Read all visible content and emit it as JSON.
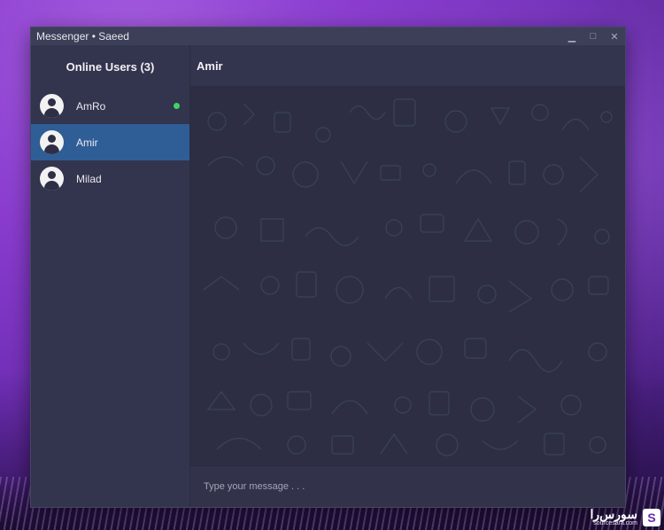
{
  "window": {
    "title": "Messenger • Saeed",
    "controls": {
      "minimize": "▁",
      "maximize": "□",
      "close": "✕"
    }
  },
  "sidebar": {
    "header": "Online Users (3)",
    "users": [
      {
        "name": "AmRo",
        "online": true,
        "active": false
      },
      {
        "name": "Amir",
        "online": false,
        "active": true
      },
      {
        "name": "Milad",
        "online": false,
        "active": false
      }
    ]
  },
  "chat": {
    "title": "Amir",
    "input_placeholder": "Type your message . . ."
  },
  "watermark": {
    "main": "سورس‌را",
    "sub": "sourcesara.com",
    "logo": "S"
  },
  "colors": {
    "active_user_bg": "#2f5d96",
    "online_indicator": "#3fd462",
    "window_bg": "#32334a",
    "desktop": "#8a3ccf"
  }
}
